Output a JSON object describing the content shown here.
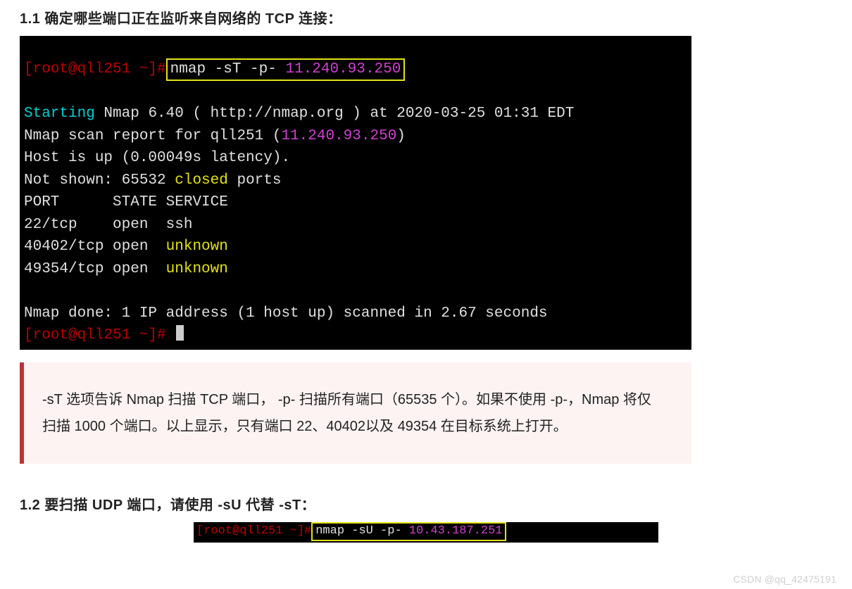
{
  "heading_1_1": "1.1 确定哪些端口正在监听来自网络的 TCP 连接：",
  "term1": {
    "prompt_open": "[root@qll251 ~]#",
    "cmd_nmap": "nmap -sT -p- ",
    "cmd_ip": "11.240.93.250",
    "line_starting_cyan": "Starting",
    "line_starting_rest": " Nmap 6.40 ( http://nmap.org ) at 2020-03-25 01:31 EDT",
    "line_report_prefix": "Nmap scan report for qll251 (",
    "line_report_ip": "11.240.93.250",
    "line_report_suffix": ")",
    "line_host": "Host is up (0.00049s latency).",
    "line_notshown_prefix": "Not shown: 65532 ",
    "line_notshown_closed": "closed",
    "line_notshown_suffix": " ports",
    "line_header": "PORT      STATE SERVICE",
    "row1_port": "22/tcp    open  ",
    "row1_svc": "ssh",
    "row2_port": "40402/tcp open  ",
    "row2_svc": "unknown",
    "row3_port": "49354/tcp open  ",
    "row3_svc": "unknown",
    "line_done": "Nmap done: 1 IP address (1 host up) scanned in 2.67 seconds",
    "prompt_end": "[root@qll251 ~]# "
  },
  "note_1_1": "-sT 选项告诉 Nmap 扫描 TCP 端口， -p- 扫描所有端口（65535 个）。如果不使用 -p-，Nmap 将仅扫描 1000 个端口。以上显示，只有端口 22、40402以及 49354 在目标系统上打开。",
  "heading_1_2": "1.2 要扫描 UDP 端口，请使用 -sU 代替 -sT：",
  "term2": {
    "prompt_open": "[root@qll251 ~]#",
    "cmd_nmap": "nmap -sU -p- ",
    "cmd_ip": "10.43.187.251"
  },
  "watermark": "CSDN @qq_42475191"
}
